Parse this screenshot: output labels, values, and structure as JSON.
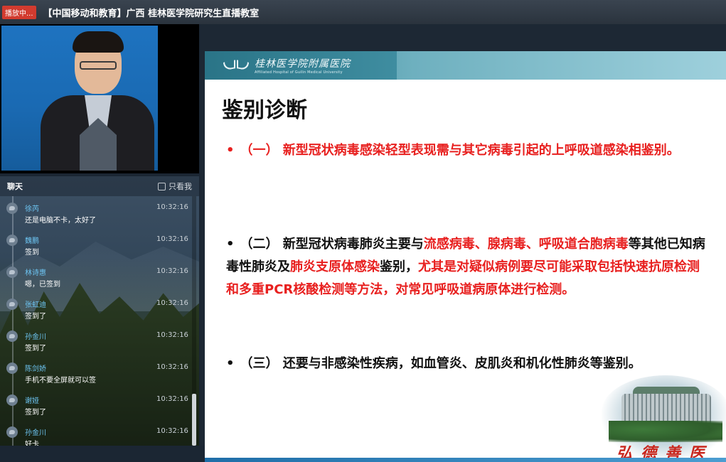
{
  "topbar": {
    "live_badge": "播放中...",
    "room_title": "【中国移动和教育】广西 桂林医学院研究生直播教室"
  },
  "chat": {
    "title": "聊天",
    "only_me_label": "只看我",
    "messages": [
      {
        "name": "徐芮",
        "time": "10:32:16",
        "text": "还是电脑不卡，太好了"
      },
      {
        "name": "魏鹏",
        "time": "10:32:16",
        "text": "签到"
      },
      {
        "name": "林诗惠",
        "time": "10:32:16",
        "text": "嗯，已签到"
      },
      {
        "name": "张虹迪",
        "time": "10:32:16",
        "text": "签到了"
      },
      {
        "name": "孙金川",
        "time": "10:32:16",
        "text": "签到了"
      },
      {
        "name": "陈剑娇",
        "time": "10:32:16",
        "text": "手机不要全屏就可以签"
      },
      {
        "name": "谢娅",
        "time": "10:32:16",
        "text": "签到了"
      },
      {
        "name": "孙金川",
        "time": "10:32:16",
        "text": "好卡"
      }
    ]
  },
  "slide": {
    "logo_cn": "桂林医学院附属医院",
    "logo_en": "Affiliated Hospital of Guilin Medical University",
    "title": "鉴别诊断",
    "bullet": "•",
    "p1": "（一） 新型冠状病毒感染轻型表现需与其它病毒引起的上呼吸道感染相鉴别。",
    "p2_a": "（二） 新型冠状病毒肺炎主要与",
    "p2_b": "流感病毒、腺病毒、呼吸道合胞病毒",
    "p2_c": "等其他已知病毒性肺炎及",
    "p2_d": "肺炎支原体感染",
    "p2_e": "鉴别，",
    "p2_f": "尤其是对疑似病例要尽可能采取包括快速抗原检测和多重PCR核酸检测等方法，对常见呼吸道病原体进行检测。",
    "p3": "（三） 还要与非感染性疾病，如血管炎、皮肌炎和机化性肺炎等鉴别。",
    "motto": "弘德善医"
  },
  "colors": {
    "accent_red": "#e8201f",
    "name_blue": "#6cc3f0",
    "live_red": "#d23b2f"
  }
}
